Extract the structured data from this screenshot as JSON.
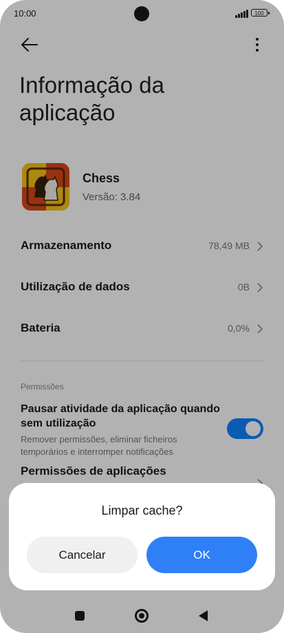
{
  "status_bar": {
    "time": "10:00",
    "battery": "100"
  },
  "header": {
    "title": "Informação da aplicação"
  },
  "app": {
    "name": "Chess",
    "version": "Versão: 3.84"
  },
  "rows": [
    {
      "label": "Armazenamento",
      "value": "78,49 MB"
    },
    {
      "label": "Utilização de dados",
      "value": "0B"
    },
    {
      "label": "Bateria",
      "value": "0,0%"
    }
  ],
  "permissions_section": {
    "label": "Permissões",
    "pause_title": "Pausar atividade da aplicação quando sem utilização",
    "pause_description": "Remover permissões, eliminar ficheiros temporários e interromper notificações",
    "pause_enabled": true,
    "app_permissions_title": "Permissões de aplicações"
  },
  "dialog": {
    "title": "Limpar cache?",
    "cancel_label": "Cancelar",
    "ok_label": "OK"
  },
  "icons": {
    "back": "back-arrow-icon",
    "more": "more-vertical-icon",
    "chevron": "chevron-right-icon",
    "nav_recent": "recent-apps-icon",
    "nav_home": "home-icon",
    "nav_back": "back-triangle-icon"
  },
  "colors": {
    "accent": "#2f7ff7",
    "toggle_on": "#0d84ff"
  }
}
